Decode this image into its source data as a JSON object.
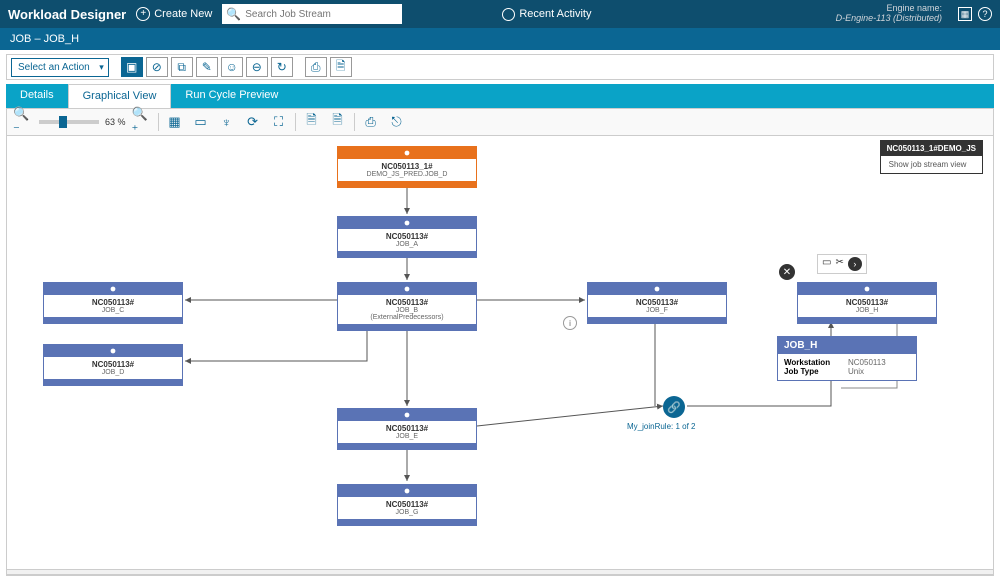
{
  "header": {
    "app_title": "Workload Designer",
    "create_new": "Create New",
    "search_placeholder": "Search Job Stream",
    "recent_activity": "Recent Activity",
    "engine_label": "Engine name:",
    "engine_value": "D-Engine-113 (Distributed)"
  },
  "breadcrumb": "JOB – JOB_H",
  "action_select": "Select an Action",
  "tabs": {
    "details": "Details",
    "graphical": "Graphical View",
    "runcycle": "Run Cycle Preview"
  },
  "zoom": "63 %",
  "info_panel": {
    "title": "NC050113_1#DEMO_JS",
    "link": "Show job stream view"
  },
  "nodes": {
    "pred": {
      "title": "NC050113_1#",
      "sub": "DEMO_JS_PRED.JOB_D"
    },
    "job_a": {
      "title": "NC050113#",
      "sub": "JOB_A"
    },
    "job_b": {
      "title": "NC050113#",
      "sub": "JOB_B",
      "note": "(ExternalPredecessors)"
    },
    "job_c": {
      "title": "NC050113#",
      "sub": "JOB_C"
    },
    "job_d": {
      "title": "NC050113#",
      "sub": "JOB_D"
    },
    "job_e": {
      "title": "NC050113#",
      "sub": "JOB_E"
    },
    "job_f": {
      "title": "NC050113#",
      "sub": "JOB_F"
    },
    "job_g": {
      "title": "NC050113#",
      "sub": "JOB_G"
    },
    "job_h": {
      "title": "NC050113#",
      "sub": "JOB_H"
    }
  },
  "join": {
    "label": "My_joinRule: 1 of 2"
  },
  "popup": {
    "title": "JOB_H",
    "rows": {
      "ws_k": "Workstation",
      "ws_v": "NC050113",
      "jt_k": "Job Type",
      "jt_v": "Unix"
    }
  }
}
